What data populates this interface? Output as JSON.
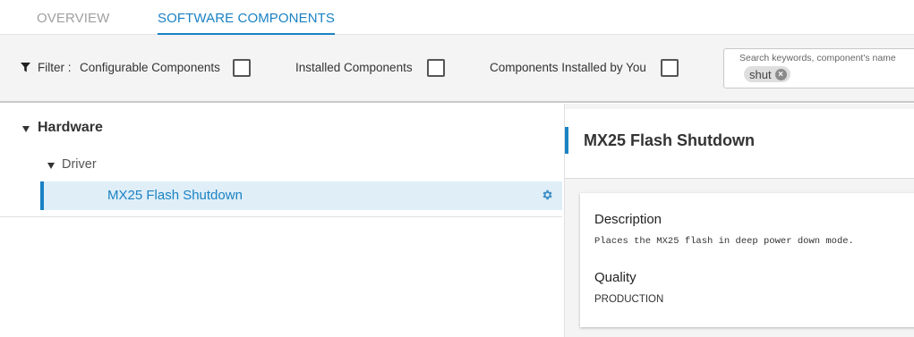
{
  "tabs": [
    {
      "label": "OVERVIEW",
      "active": false
    },
    {
      "label": "SOFTWARE COMPONENTS",
      "active": true
    }
  ],
  "filter": {
    "label": "Filter :",
    "options": [
      {
        "label": "Configurable Components",
        "checked": false
      },
      {
        "label": "Installed Components",
        "checked": false
      },
      {
        "label": "Components Installed by You",
        "checked": false
      }
    ]
  },
  "search": {
    "placeholder": "Search keywords, component's name",
    "chip": "shut"
  },
  "tree": {
    "category": "Hardware",
    "subcategory": "Driver",
    "selected_item": "MX25 Flash Shutdown"
  },
  "detail": {
    "title": "MX25 Flash Shutdown",
    "description_heading": "Description",
    "description": "Places the MX25 flash in deep power down mode.",
    "quality_heading": "Quality",
    "quality": "PRODUCTION"
  },
  "colors": {
    "accent": "#1a82c4",
    "selected_row_bg": "#dfeef7",
    "filter_bg": "#f4f4f4"
  },
  "icons": [
    "filter-funnel-icon",
    "close-circle-icon",
    "caret-down-icon",
    "gear-icon"
  ]
}
